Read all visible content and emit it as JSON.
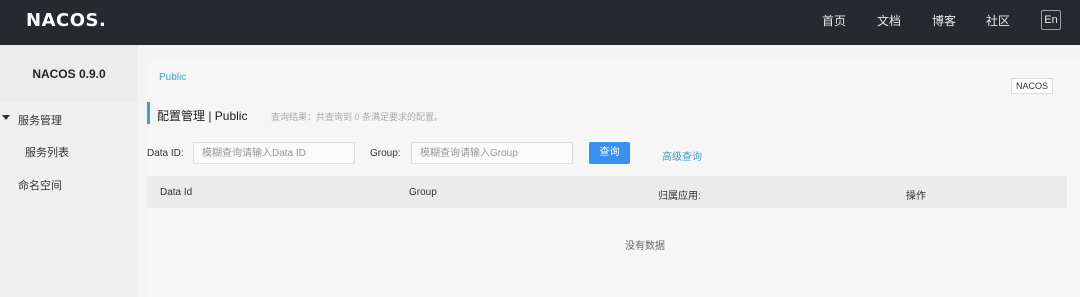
{
  "header": {
    "logo": "NACOS.",
    "nav": [
      "首页",
      "文档",
      "博客",
      "社区"
    ],
    "lang": "En"
  },
  "sidebar": {
    "title": "NACOS 0.9.0",
    "items": [
      {
        "label": "服务管理"
      },
      {
        "label": "服务列表"
      },
      {
        "label": "命名空间"
      }
    ]
  },
  "main": {
    "breadcrumb": "Public",
    "namespace_badge": "NACOS",
    "title": "配置管理 | Public",
    "subtitle": "查询结果：共查询到 0 条满足要求的配置。",
    "filters": {
      "data_id_label": "Data ID:",
      "data_id_placeholder": "模糊查询请输入Data ID",
      "group_label": "Group:",
      "group_placeholder": "模糊查询请输入Group",
      "search_button": "查询",
      "advanced_link": "高级查询"
    },
    "table": {
      "columns": [
        "Data Id",
        "Group",
        "归属应用:",
        "操作"
      ],
      "empty": "没有数据"
    }
  },
  "colors": {
    "topbar": "#262a2e",
    "accent": "#3aa0d8",
    "button": "#3b8fef"
  }
}
